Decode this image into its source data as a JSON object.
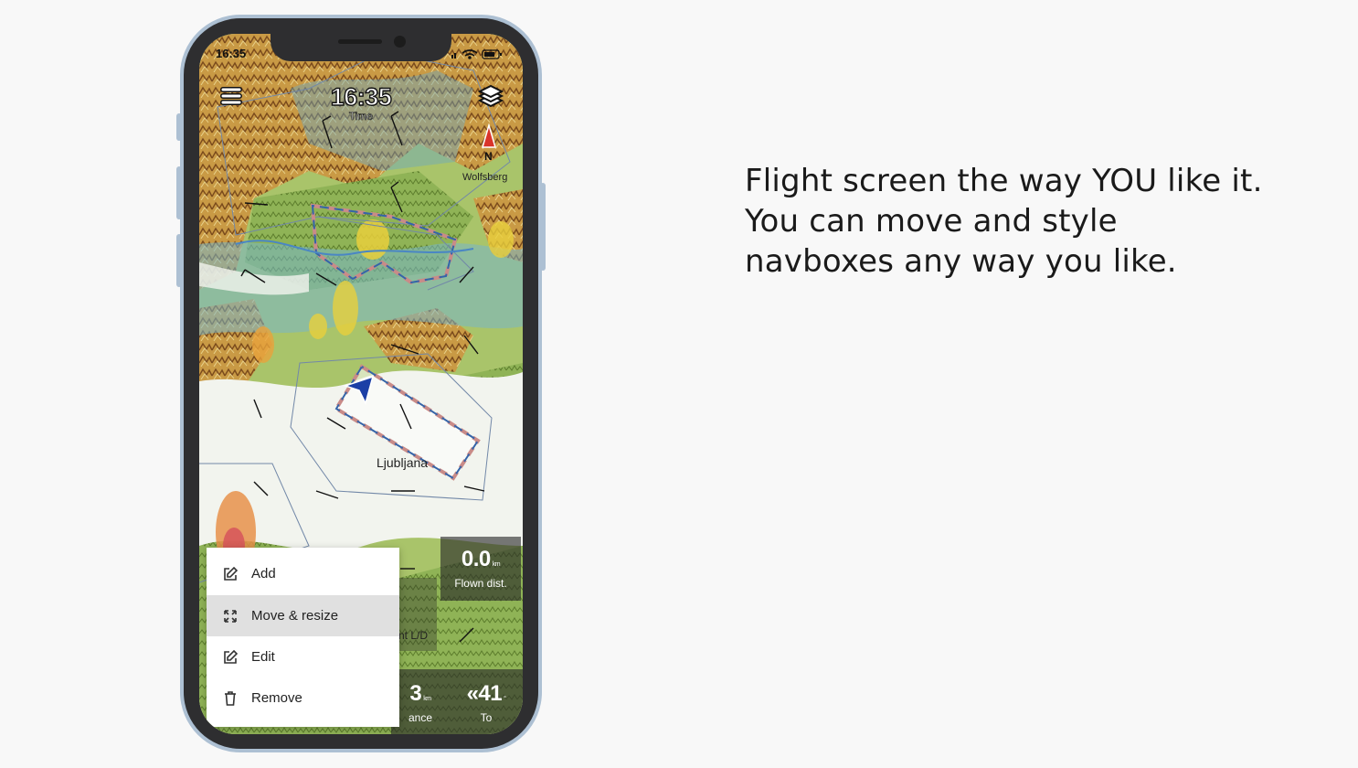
{
  "headline": "Flight screen the way YOU like it. You can move and style navboxes any way you like.",
  "status_bar": {
    "time": "16:35"
  },
  "map": {
    "clock": {
      "value": "16:35",
      "label": "Time"
    },
    "compass_label": "N",
    "places": {
      "wolfsberg": "Wolfsberg",
      "ljubljana": "Ljubljana"
    }
  },
  "navboxes": {
    "flown_distance": {
      "value": "0.0",
      "unit": "km",
      "label": "Flown dist."
    },
    "glide_ratio": {
      "label": "nt L/D"
    },
    "distance": {
      "value": "3",
      "unit": "km",
      "label": "ance"
    },
    "to_waypoint": {
      "value": "«41",
      "unit": "°",
      "label": "To"
    }
  },
  "context_menu": {
    "items": [
      {
        "label": "Add",
        "icon": "edit-icon",
        "active": false
      },
      {
        "label": "Move & resize",
        "icon": "resize-icon",
        "active": true
      },
      {
        "label": "Edit",
        "icon": "edit-icon",
        "active": false
      },
      {
        "label": "Remove",
        "icon": "trash-icon",
        "active": false
      }
    ]
  },
  "colors": {
    "background": "#f8f8f8",
    "phone_frame": "#adc0d3",
    "aircraft": "#1b3fa6",
    "compass_north": "#d9342b"
  }
}
